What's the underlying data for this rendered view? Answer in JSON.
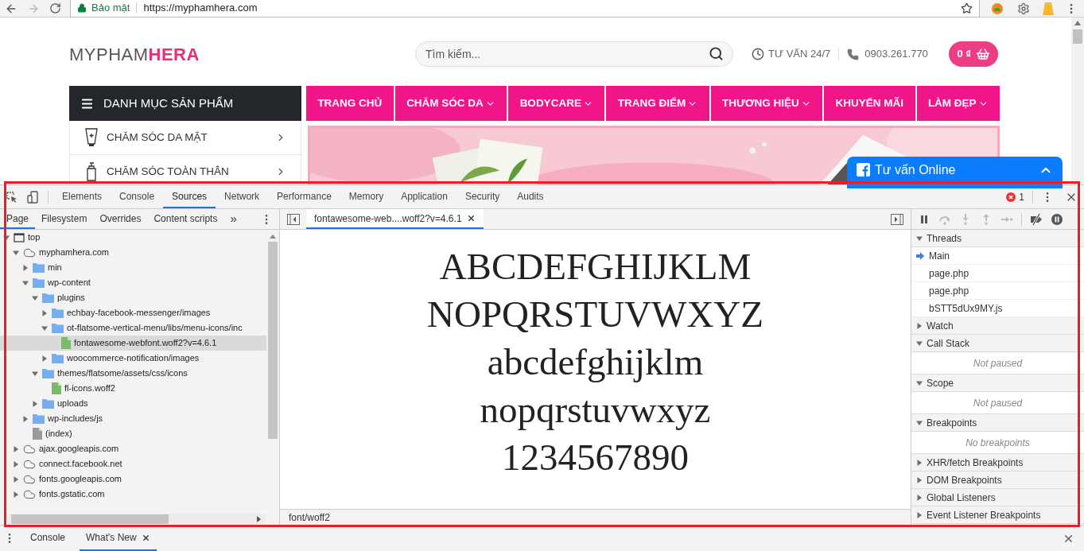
{
  "browser": {
    "security_label": "Bảo mật",
    "url": "https://myphamhera.com"
  },
  "site": {
    "logo": "MYPHAM**HERA**",
    "search": {
      "placeholder": "Tìm kiếm..."
    },
    "hotline_label": "TƯ VẤN 24/7",
    "phone": "0903.261.770",
    "cart": "0 ₫",
    "category_menu": {
      "title": "DANH MỤC SẢN PHẨM",
      "items": [
        {
          "label": "CHĂM SÓC DA MẶT",
          "kind": "tube"
        },
        {
          "label": "CHĂM SÓC TOÀN THÂN",
          "kind": "bottle"
        }
      ]
    },
    "nav": [
      {
        "label": "TRANG CHỦ",
        "dropdown": false
      },
      {
        "label": "CHĂM SÓC DA",
        "dropdown": true
      },
      {
        "label": "BODYCARE",
        "dropdown": true
      },
      {
        "label": "TRANG ĐIỂM",
        "dropdown": true
      },
      {
        "label": "THƯƠNG HIỆU",
        "dropdown": true
      },
      {
        "label": "KHUYẾN MÃI",
        "dropdown": false
      },
      {
        "label": "LÀM ĐẸP",
        "dropdown": true
      }
    ],
    "chat_widget": {
      "title": "Tư vấn Online"
    }
  },
  "devtools": {
    "tabs": [
      {
        "label": "Elements",
        "selected": false
      },
      {
        "label": "Console",
        "selected": false
      },
      {
        "label": "Sources",
        "selected": true
      },
      {
        "label": "Network",
        "selected": false
      },
      {
        "label": "Performance",
        "selected": false
      },
      {
        "label": "Memory",
        "selected": false
      },
      {
        "label": "Application",
        "selected": false
      },
      {
        "label": "Security",
        "selected": false
      },
      {
        "label": "Audits",
        "selected": false
      }
    ],
    "error_count": "1",
    "navigator_tabs": [
      {
        "label": "Page",
        "selected": true
      },
      {
        "label": "Filesystem",
        "selected": false
      },
      {
        "label": "Overrides",
        "selected": false
      },
      {
        "label": "Content scripts",
        "selected": false
      }
    ],
    "more_tabs": "»",
    "tree": [
      {
        "label": "top",
        "kind": "frame",
        "expanded": true,
        "selected": false,
        "children": [
          {
            "label": "myphamhera.com",
            "kind": "domain",
            "expanded": true,
            "selected": false,
            "children": [
              {
                "label": "min",
                "kind": "folder",
                "expanded": false,
                "selected": false
              },
              {
                "label": "wp-content",
                "kind": "folder",
                "expanded": true,
                "selected": false,
                "children": [
                  {
                    "label": "plugins",
                    "kind": "folder",
                    "expanded": true,
                    "selected": false,
                    "children": [
                      {
                        "label": "echbay-facebook-messenger/images",
                        "kind": "folder",
                        "expanded": false,
                        "selected": false
                      },
                      {
                        "label": "ot-flatsome-vertical-menu/libs/menu-icons/inc",
                        "kind": "folder",
                        "expanded": true,
                        "selected": false,
                        "children": [
                          {
                            "label": "fontawesome-webfont.woff2?v=4.6.1",
                            "kind": "font",
                            "selected": true
                          }
                        ]
                      },
                      {
                        "label": "woocommerce-notification/images",
                        "kind": "folder",
                        "expanded": false,
                        "selected": false
                      }
                    ]
                  },
                  {
                    "label": "themes/flatsome/assets/css/icons",
                    "kind": "folder",
                    "expanded": true,
                    "selected": false,
                    "children": [
                      {
                        "label": "fl-icons.woff2",
                        "kind": "font",
                        "selected": false
                      }
                    ]
                  },
                  {
                    "label": "uploads",
                    "kind": "folder",
                    "expanded": false,
                    "selected": false
                  }
                ]
              },
              {
                "label": "wp-includes/js",
                "kind": "folder",
                "expanded": false,
                "selected": false
              },
              {
                "label": "(index)",
                "kind": "document",
                "selected": false
              }
            ]
          },
          {
            "label": "ajax.googleapis.com",
            "kind": "domain",
            "expanded": false,
            "selected": false
          },
          {
            "label": "connect.facebook.net",
            "kind": "domain",
            "expanded": false,
            "selected": false
          },
          {
            "label": "fonts.googleapis.com",
            "kind": "domain",
            "expanded": false,
            "selected": false
          },
          {
            "label": "fonts.gstatic.com",
            "kind": "domain",
            "expanded": false,
            "selected": false
          }
        ]
      }
    ],
    "editor_tab": {
      "label": "fontawesome-web....woff2?v=4.6.1",
      "selected": true
    },
    "preview_lines": [
      "ABCDEFGHIJKLM",
      "NOPQRSTUVWXYZ",
      "abcdefghijklm",
      "nopqrstuvwxyz",
      "1234567890"
    ],
    "mime_type": "font/woff2",
    "debugger_controls": [
      {
        "kind": "pause",
        "disabled": false
      },
      {
        "kind": "step-over",
        "disabled": true
      },
      {
        "kind": "step-into",
        "disabled": true
      },
      {
        "kind": "step-out",
        "disabled": true
      },
      {
        "kind": "step",
        "disabled": true
      },
      {
        "kind": "deactivate",
        "disabled": false
      },
      {
        "kind": "pause-exceptions",
        "disabled": false
      }
    ],
    "sections": [
      {
        "title": "Threads",
        "expanded": true,
        "items": [
          {
            "label": "Main",
            "selected": true
          },
          {
            "label": "page.php",
            "selected": false
          },
          {
            "label": "page.php",
            "selected": false
          },
          {
            "label": "bSTT5dUx9MY.js",
            "selected": false
          }
        ]
      },
      {
        "title": "Watch",
        "expanded": false
      },
      {
        "title": "Call Stack",
        "expanded": true,
        "placeholder": "Not paused"
      },
      {
        "title": "Scope",
        "expanded": true,
        "placeholder": "Not paused"
      },
      {
        "title": "Breakpoints",
        "expanded": true,
        "placeholder": "No breakpoints"
      },
      {
        "title": "XHR/fetch Breakpoints",
        "expanded": false
      },
      {
        "title": "DOM Breakpoints",
        "expanded": false
      },
      {
        "title": "Global Listeners",
        "expanded": false
      },
      {
        "title": "Event Listener Breakpoints",
        "expanded": false
      }
    ]
  },
  "drawer": {
    "tabs": [
      {
        "label": "Console",
        "selected": false,
        "closable": false
      },
      {
        "label": "What's New",
        "selected": true,
        "closable": true
      }
    ]
  }
}
